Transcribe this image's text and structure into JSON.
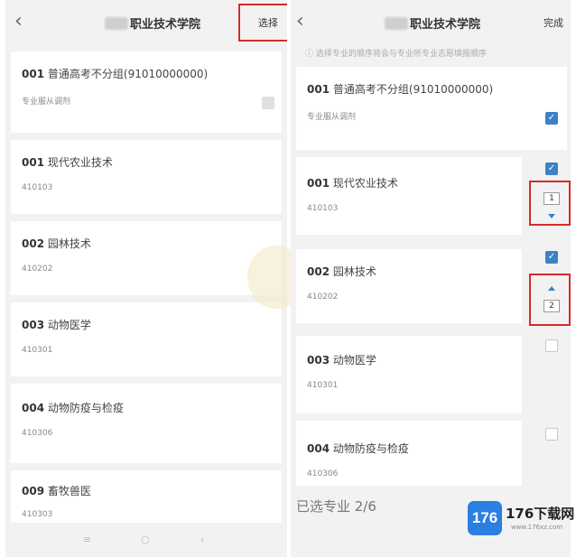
{
  "left": {
    "title": "职业技术学院",
    "action": "选择",
    "cards": [
      {
        "code": "001",
        "name": "普通高考不分组(91010000000)",
        "sub": "专业服从调剂"
      },
      {
        "code": "001",
        "name": "现代农业技术",
        "sub": "410103"
      },
      {
        "code": "002",
        "name": "园林技术",
        "sub": "410202"
      },
      {
        "code": "003",
        "name": "动物医学",
        "sub": "410301"
      },
      {
        "code": "004",
        "name": "动物防疫与检疫",
        "sub": "410306"
      },
      {
        "code": "009",
        "name": "畜牧兽医",
        "sub": "410303"
      }
    ]
  },
  "right": {
    "title": "职业技术学院",
    "action": "完成",
    "hint": "选择专业的顺序将会与专业所专业志愿填报顺序",
    "cards": [
      {
        "code": "001",
        "name": "普通高考不分组(91010000000)",
        "sub": "专业服从调剂",
        "checked": true
      },
      {
        "code": "001",
        "name": "现代农业技术",
        "sub": "410103",
        "checked": true,
        "order": "1"
      },
      {
        "code": "002",
        "name": "园林技术",
        "sub": "410202",
        "checked": true,
        "order": "2"
      },
      {
        "code": "003",
        "name": "动物医学",
        "sub": "410301",
        "checked": false
      },
      {
        "code": "004",
        "name": "动物防疫与检疫",
        "sub": "410306",
        "checked": false
      }
    ],
    "selected_label": "已选专业 2/6"
  },
  "watermark": {
    "logo": "176",
    "name": "176下载网",
    "url": "www.176xz.com"
  },
  "colors": {
    "accent": "#3b82c4",
    "highlight": "#d62a2a"
  },
  "icons": {
    "back": "chevron-left-icon",
    "check": "check-icon",
    "up": "arrow-up-icon",
    "down": "arrow-down-icon"
  }
}
